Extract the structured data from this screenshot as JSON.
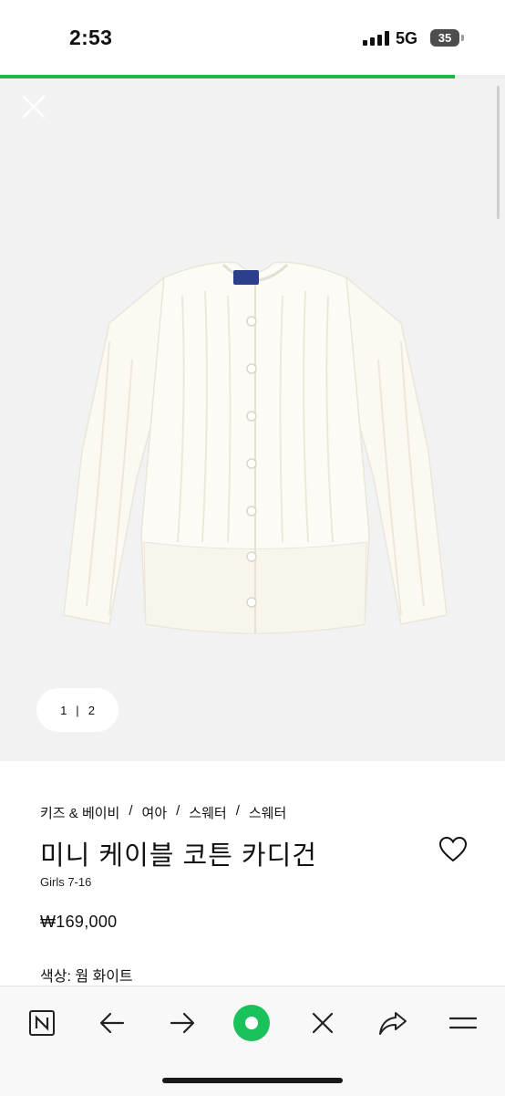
{
  "status_bar": {
    "time": "2:53",
    "network": "5G",
    "battery": "35",
    "signal_icon": "cellular-signal-icon"
  },
  "page_load_progress": 0.9,
  "image_viewer": {
    "close_icon": "close-icon",
    "product_image": "white-cable-knit-cardigan",
    "pager": {
      "current": "1",
      "separator": "|",
      "total": "2"
    }
  },
  "product": {
    "breadcrumb": [
      {
        "label": "키즈 & 베이비"
      },
      {
        "label": "여아"
      },
      {
        "label": "스웨터"
      },
      {
        "label": "스웨터"
      }
    ],
    "breadcrumb_separator": "/",
    "title": "미니 케이블 코튼 카디건",
    "sizing": "Girls 7-16",
    "price": "₩169,000",
    "color": "색상: 웜 화이트",
    "wishlist_icon": "heart-outline-icon"
  },
  "toolbar": {
    "items": [
      {
        "icon": "naver-n-icon"
      },
      {
        "icon": "back-arrow-icon"
      },
      {
        "icon": "forward-arrow-icon"
      },
      {
        "icon": "green-home-button-icon"
      },
      {
        "icon": "close-icon"
      },
      {
        "icon": "share-icon"
      },
      {
        "icon": "menu-icon"
      }
    ]
  },
  "colors": {
    "accent": "#1fb645",
    "image_bg": "#f2f2f2",
    "toolbar_bg": "#f8f8f8"
  }
}
